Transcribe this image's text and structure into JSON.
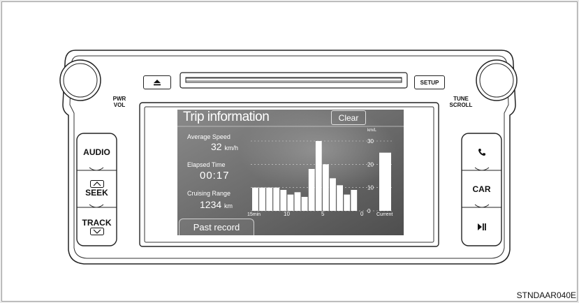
{
  "labels": {
    "pwr": "PWR",
    "vol": "VOL",
    "tune": "TUNE",
    "scroll": "SCROLL",
    "setup": "SETUP",
    "audio": "AUDIO",
    "seek": "SEEK",
    "track": "TRACK",
    "car": "CAR",
    "code": "STNDAAR040E"
  },
  "screen": {
    "title": "Trip information",
    "clear": "Clear",
    "avg_speed_label": "Average Speed",
    "avg_speed_value": "32",
    "avg_speed_unit": "km/h",
    "elapsed_label": "Elapsed Time",
    "elapsed_value": "00:17",
    "range_label": "Cruising Range",
    "range_value": "1234",
    "range_unit": "km",
    "past_record": "Past record"
  },
  "chart_data": {
    "type": "bar",
    "y_unit": "km/L",
    "ylim": [
      0,
      30
    ],
    "y_ticks": [
      "30",
      "20",
      "10",
      "0"
    ],
    "x_ticks": [
      "15min",
      "10",
      "5",
      "0",
      "Current"
    ],
    "values": [
      10,
      10,
      10,
      10,
      9,
      7,
      8,
      6,
      18,
      30,
      20,
      14,
      11,
      7,
      9
    ],
    "current": 25
  },
  "icons": {
    "eject": "eject-icon",
    "phone": "phone-icon",
    "play_pause": "play-pause-icon",
    "seek_up": "seek-up-icon",
    "track_down": "track-down-icon"
  }
}
